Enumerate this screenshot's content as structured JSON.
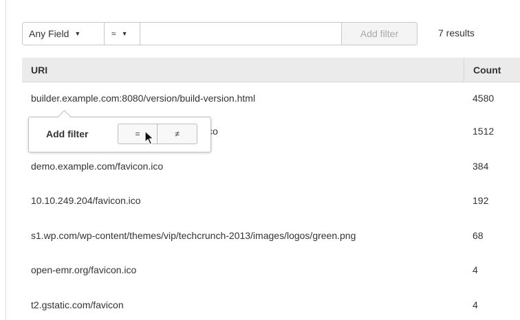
{
  "filter_bar": {
    "field_label": "Any Field",
    "operator_label": "≈",
    "value": "",
    "placeholder": "",
    "add_filter_label": "Add filter",
    "results": "7 results"
  },
  "table": {
    "headers": {
      "uri": "URI",
      "count": "Count"
    },
    "rows": [
      {
        "uri": "builder.example.com:8080/version/build-version.html",
        "count": "4580"
      },
      {
        "uri": "ico",
        "count": "1512"
      },
      {
        "uri": "demo.example.com/favicon.ico",
        "count": "384"
      },
      {
        "uri": "10.10.249.204/favicon.ico",
        "count": "192"
      },
      {
        "uri": "s1.wp.com/wp-content/themes/vip/techcrunch-2013/images/logos/green.png",
        "count": "68"
      },
      {
        "uri": "open-emr.org/favicon.ico",
        "count": "4"
      },
      {
        "uri": "t2.gstatic.com/favicon",
        "count": "4"
      }
    ]
  },
  "popup": {
    "label": "Add filter",
    "equals_label": "=",
    "not_equals_label": "≠"
  },
  "icons": {
    "caret": "chevron-down-icon",
    "cursor": "mouse-pointer-icon"
  }
}
